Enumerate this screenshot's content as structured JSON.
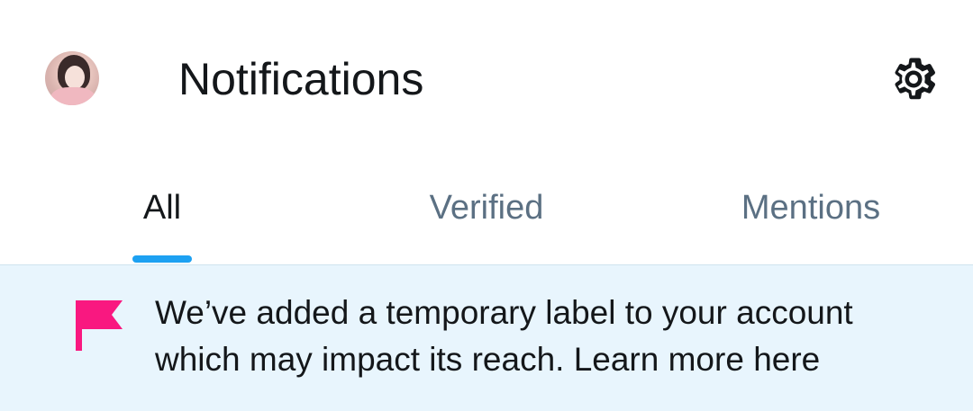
{
  "header": {
    "title": "Notifications",
    "avatar_icon": "profile-avatar",
    "settings_icon": "gear-icon"
  },
  "tabs": [
    {
      "label": "All",
      "active": true
    },
    {
      "label": "Verified",
      "active": false
    },
    {
      "label": "Mentions",
      "active": false
    }
  ],
  "banner": {
    "icon": "flag-icon",
    "text": "We’ve added a temporary label to your account which may impact its reach. Learn more here"
  },
  "colors": {
    "accent": "#1da1f2",
    "banner_bg": "#e8f5fd",
    "flag": "#f91880",
    "text_primary": "#14171a",
    "text_secondary": "#5b7083"
  }
}
